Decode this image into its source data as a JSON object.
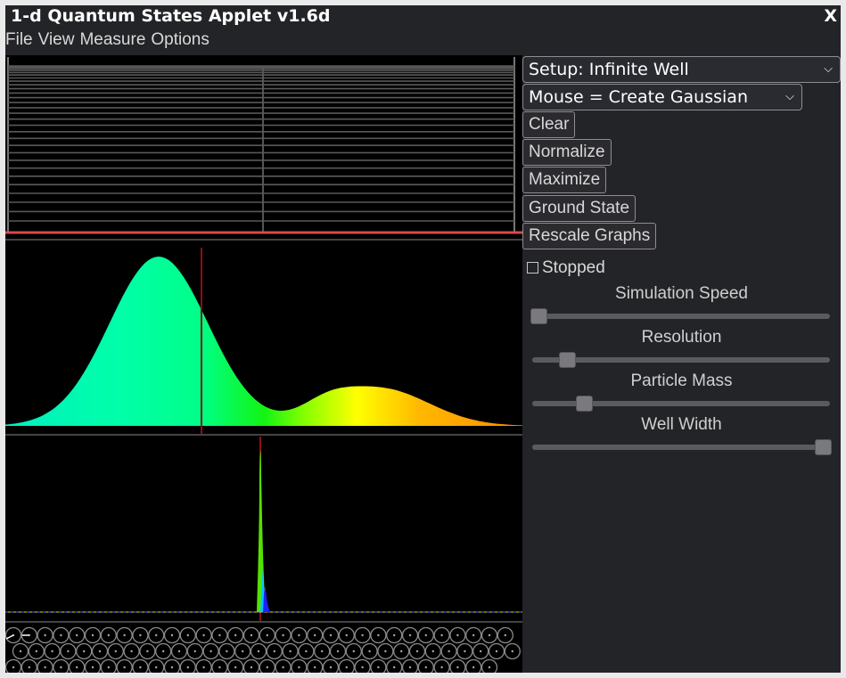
{
  "window": {
    "title": "1-d Quantum States Applet v1.6d",
    "close_label": "X"
  },
  "menubar": {
    "items": [
      "File",
      "View",
      "Measure",
      "Options"
    ]
  },
  "panel": {
    "setup_select": {
      "value": "Setup: Infinite Well"
    },
    "mouse_select": {
      "value": "Mouse = Create Gaussian"
    },
    "buttons": {
      "clear": "Clear",
      "normalize": "Normalize",
      "maximize": "Maximize",
      "ground_state": "Ground State",
      "rescale_graphs": "Rescale Graphs"
    },
    "stopped": {
      "label": "Stopped",
      "checked": false
    },
    "sliders": [
      {
        "label": "Simulation Speed",
        "value": 0.0
      },
      {
        "label": "Resolution",
        "value": 0.1
      },
      {
        "label": "Particle Mass",
        "value": 0.16
      },
      {
        "label": "Well Width",
        "value": 1.0
      }
    ]
  },
  "colors": {
    "window_bg": "#232427",
    "plot_bg": "#000000",
    "level_line": "#5a5a5a",
    "potential": "#e05050",
    "measure_line": "#8b1010"
  },
  "icons": {
    "stopped_checkbox": "checkbox-empty-icon",
    "dropdown": "chevron-down-icon",
    "state_phasor": "phasor-circle-icon"
  }
}
